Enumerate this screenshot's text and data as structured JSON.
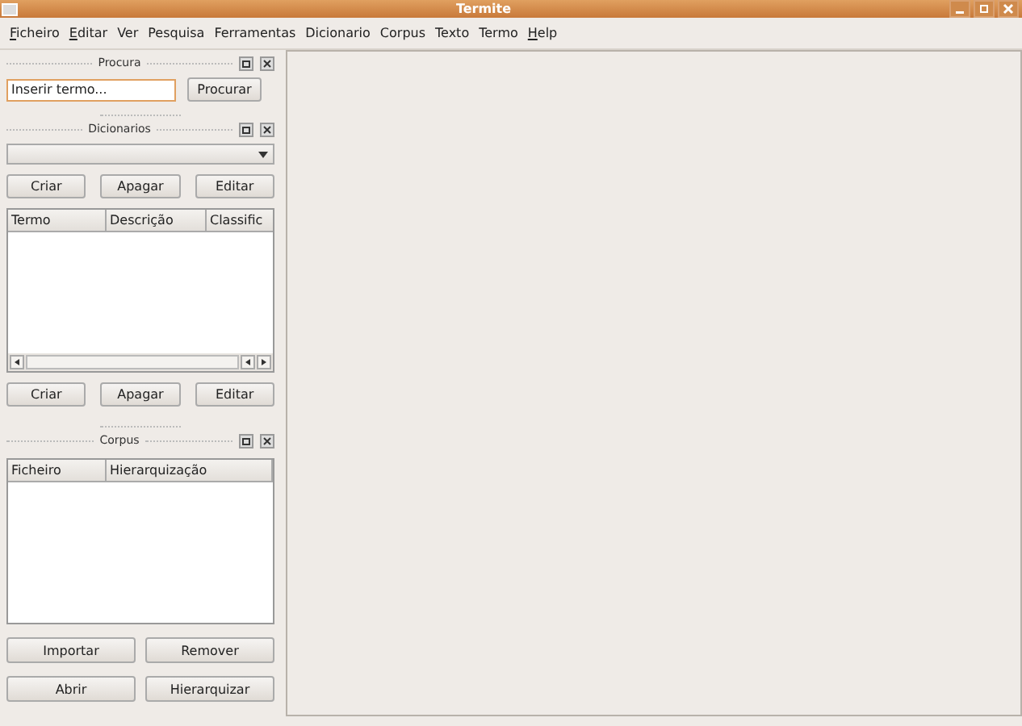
{
  "window": {
    "title": "Termite"
  },
  "menu": [
    {
      "label": "Ficheiro",
      "underline_first": true
    },
    {
      "label": "Editar",
      "underline_first": true
    },
    {
      "label": "Ver",
      "underline_first": false
    },
    {
      "label": "Pesquisa",
      "underline_first": false
    },
    {
      "label": "Ferramentas",
      "underline_first": false
    },
    {
      "label": "Dicionario",
      "underline_first": false
    },
    {
      "label": "Corpus",
      "underline_first": false
    },
    {
      "label": "Texto",
      "underline_first": false
    },
    {
      "label": "Termo",
      "underline_first": false
    },
    {
      "label": "Help",
      "underline_first": true
    }
  ],
  "procura": {
    "title": "Procura",
    "placeholder": "Inserir termo...",
    "button": "Procurar"
  },
  "dicionarios": {
    "title": "Dicionarios",
    "buttons_top": [
      "Criar",
      "Apagar",
      "Editar"
    ],
    "columns": [
      "Termo",
      "Descrição",
      "Classific"
    ],
    "buttons_bottom": [
      "Criar",
      "Apagar",
      "Editar"
    ]
  },
  "corpus": {
    "title": "Corpus",
    "columns": [
      "Ficheiro",
      "Hierarquização"
    ],
    "buttons": [
      "Importar",
      "Remover",
      "Abrir",
      "Hierarquizar"
    ]
  }
}
